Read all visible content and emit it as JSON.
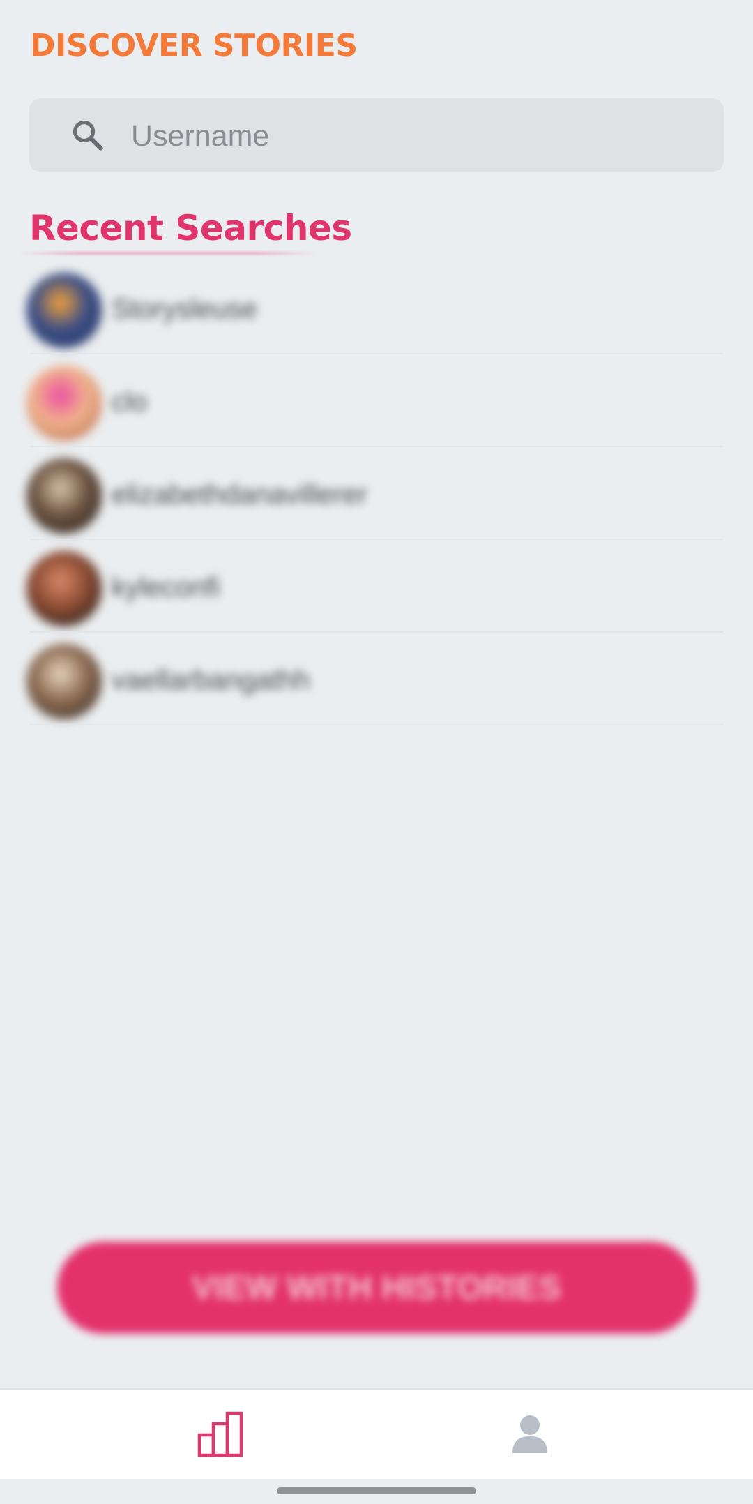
{
  "header": {
    "title": "DISCOVER STORIES"
  },
  "search": {
    "placeholder": "Username",
    "value": "",
    "icon": "search-icon"
  },
  "recent": {
    "title": "Recent Searches",
    "items": [
      {
        "username": "Storysleuse",
        "avatar_colors": [
          "#f2a13a",
          "#3c4f86",
          "#2b3a6b"
        ]
      },
      {
        "username": "clo",
        "avatar_colors": [
          "#ec4fa2",
          "#f0b38c",
          "#c47a5c"
        ]
      },
      {
        "username": "elizabethdanavillerer",
        "avatar_colors": [
          "#d9c4a8",
          "#6b5240",
          "#3a2e26"
        ]
      },
      {
        "username": "kyleconfi",
        "avatar_colors": [
          "#d98a6a",
          "#8a4a32",
          "#3a2a22"
        ]
      },
      {
        "username": "vaellarbangathh",
        "avatar_colors": [
          "#e8d4bc",
          "#8b6a52",
          "#4a3a30"
        ]
      }
    ]
  },
  "cta": {
    "label": "VIEW WITH HISTORIES",
    "color": "#e3316c"
  },
  "bottom_nav": {
    "tabs": [
      {
        "name": "stats",
        "icon": "bar-chart-icon",
        "active": true,
        "color": "#d83a72"
      },
      {
        "name": "profile",
        "icon": "user-icon",
        "active": false,
        "color": "#b8bec8"
      }
    ]
  },
  "colors": {
    "title_accent": "#f47a3a",
    "section_accent": "#e0346c",
    "background": "#ebeef0"
  }
}
